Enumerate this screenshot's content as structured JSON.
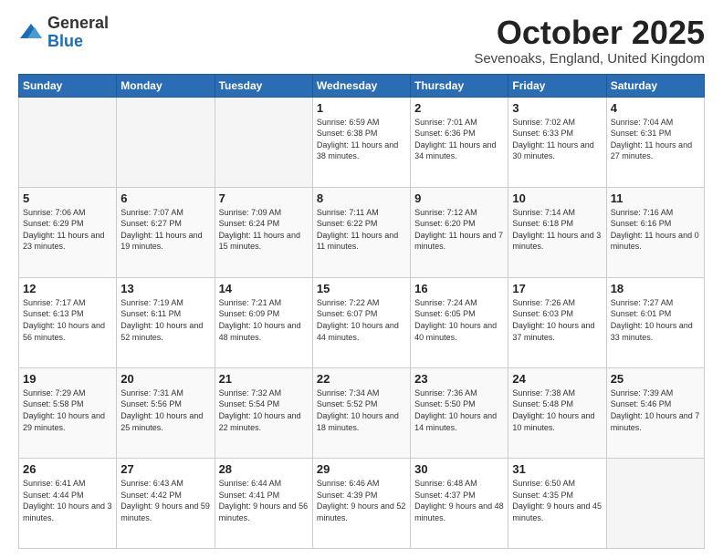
{
  "header": {
    "logo_general": "General",
    "logo_blue": "Blue",
    "month_title": "October 2025",
    "location": "Sevenoaks, England, United Kingdom"
  },
  "weekdays": [
    "Sunday",
    "Monday",
    "Tuesday",
    "Wednesday",
    "Thursday",
    "Friday",
    "Saturday"
  ],
  "weeks": [
    [
      {
        "day": "",
        "sunrise": "",
        "sunset": "",
        "daylight": ""
      },
      {
        "day": "",
        "sunrise": "",
        "sunset": "",
        "daylight": ""
      },
      {
        "day": "",
        "sunrise": "",
        "sunset": "",
        "daylight": ""
      },
      {
        "day": "1",
        "sunrise": "6:59 AM",
        "sunset": "6:38 PM",
        "daylight": "11 hours and 38 minutes."
      },
      {
        "day": "2",
        "sunrise": "7:01 AM",
        "sunset": "6:36 PM",
        "daylight": "11 hours and 34 minutes."
      },
      {
        "day": "3",
        "sunrise": "7:02 AM",
        "sunset": "6:33 PM",
        "daylight": "11 hours and 30 minutes."
      },
      {
        "day": "4",
        "sunrise": "7:04 AM",
        "sunset": "6:31 PM",
        "daylight": "11 hours and 27 minutes."
      }
    ],
    [
      {
        "day": "5",
        "sunrise": "7:06 AM",
        "sunset": "6:29 PM",
        "daylight": "11 hours and 23 minutes."
      },
      {
        "day": "6",
        "sunrise": "7:07 AM",
        "sunset": "6:27 PM",
        "daylight": "11 hours and 19 minutes."
      },
      {
        "day": "7",
        "sunrise": "7:09 AM",
        "sunset": "6:24 PM",
        "daylight": "11 hours and 15 minutes."
      },
      {
        "day": "8",
        "sunrise": "7:11 AM",
        "sunset": "6:22 PM",
        "daylight": "11 hours and 11 minutes."
      },
      {
        "day": "9",
        "sunrise": "7:12 AM",
        "sunset": "6:20 PM",
        "daylight": "11 hours and 7 minutes."
      },
      {
        "day": "10",
        "sunrise": "7:14 AM",
        "sunset": "6:18 PM",
        "daylight": "11 hours and 3 minutes."
      },
      {
        "day": "11",
        "sunrise": "7:16 AM",
        "sunset": "6:16 PM",
        "daylight": "11 hours and 0 minutes."
      }
    ],
    [
      {
        "day": "12",
        "sunrise": "7:17 AM",
        "sunset": "6:13 PM",
        "daylight": "10 hours and 56 minutes."
      },
      {
        "day": "13",
        "sunrise": "7:19 AM",
        "sunset": "6:11 PM",
        "daylight": "10 hours and 52 minutes."
      },
      {
        "day": "14",
        "sunrise": "7:21 AM",
        "sunset": "6:09 PM",
        "daylight": "10 hours and 48 minutes."
      },
      {
        "day": "15",
        "sunrise": "7:22 AM",
        "sunset": "6:07 PM",
        "daylight": "10 hours and 44 minutes."
      },
      {
        "day": "16",
        "sunrise": "7:24 AM",
        "sunset": "6:05 PM",
        "daylight": "10 hours and 40 minutes."
      },
      {
        "day": "17",
        "sunrise": "7:26 AM",
        "sunset": "6:03 PM",
        "daylight": "10 hours and 37 minutes."
      },
      {
        "day": "18",
        "sunrise": "7:27 AM",
        "sunset": "6:01 PM",
        "daylight": "10 hours and 33 minutes."
      }
    ],
    [
      {
        "day": "19",
        "sunrise": "7:29 AM",
        "sunset": "5:58 PM",
        "daylight": "10 hours and 29 minutes."
      },
      {
        "day": "20",
        "sunrise": "7:31 AM",
        "sunset": "5:56 PM",
        "daylight": "10 hours and 25 minutes."
      },
      {
        "day": "21",
        "sunrise": "7:32 AM",
        "sunset": "5:54 PM",
        "daylight": "10 hours and 22 minutes."
      },
      {
        "day": "22",
        "sunrise": "7:34 AM",
        "sunset": "5:52 PM",
        "daylight": "10 hours and 18 minutes."
      },
      {
        "day": "23",
        "sunrise": "7:36 AM",
        "sunset": "5:50 PM",
        "daylight": "10 hours and 14 minutes."
      },
      {
        "day": "24",
        "sunrise": "7:38 AM",
        "sunset": "5:48 PM",
        "daylight": "10 hours and 10 minutes."
      },
      {
        "day": "25",
        "sunrise": "7:39 AM",
        "sunset": "5:46 PM",
        "daylight": "10 hours and 7 minutes."
      }
    ],
    [
      {
        "day": "26",
        "sunrise": "6:41 AM",
        "sunset": "4:44 PM",
        "daylight": "10 hours and 3 minutes."
      },
      {
        "day": "27",
        "sunrise": "6:43 AM",
        "sunset": "4:42 PM",
        "daylight": "9 hours and 59 minutes."
      },
      {
        "day": "28",
        "sunrise": "6:44 AM",
        "sunset": "4:41 PM",
        "daylight": "9 hours and 56 minutes."
      },
      {
        "day": "29",
        "sunrise": "6:46 AM",
        "sunset": "4:39 PM",
        "daylight": "9 hours and 52 minutes."
      },
      {
        "day": "30",
        "sunrise": "6:48 AM",
        "sunset": "4:37 PM",
        "daylight": "9 hours and 48 minutes."
      },
      {
        "day": "31",
        "sunrise": "6:50 AM",
        "sunset": "4:35 PM",
        "daylight": "9 hours and 45 minutes."
      },
      {
        "day": "",
        "sunrise": "",
        "sunset": "",
        "daylight": ""
      }
    ]
  ]
}
